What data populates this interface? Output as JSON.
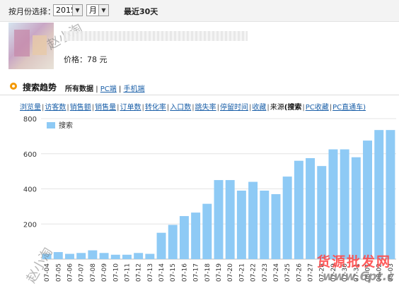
{
  "filter": {
    "label": "按月份选择：",
    "year": "2015",
    "month": "月",
    "recent": "最近30天"
  },
  "product": {
    "price_label": "价格：",
    "price_value": "78 元"
  },
  "section": {
    "title": "搜索趋势",
    "tabs": [
      "所有数据",
      "PC端",
      "手机端"
    ],
    "tab_sep": "|"
  },
  "metrics": {
    "items": [
      "浏览量",
      "访客数",
      "销售额",
      "销售量",
      "订单数",
      "转化率",
      "入口数",
      "跳失率",
      "停留时间",
      "收藏"
    ],
    "source_label": "来源",
    "source_current": "(搜索",
    "source_items": [
      "PC收藏",
      "PC直通车)"
    ],
    "sep": "|"
  },
  "watermarks": {
    "author_top": "赵小淘",
    "author_bottom": "赵小淘",
    "brand": "货源批发网",
    "url": "www.6pt.c"
  },
  "colors": {
    "bar": "#8ecaf5",
    "accent": "#f39800",
    "link": "#1a5fa8"
  },
  "chart_data": {
    "type": "bar",
    "title": "",
    "xlabel": "",
    "ylabel": "",
    "ylim": [
      0,
      800
    ],
    "yticks": [
      200,
      400,
      600,
      800
    ],
    "legend": "top-left",
    "grid": true,
    "categories": [
      "07-04",
      "07-05",
      "07-06",
      "07-07",
      "07-08",
      "07-09",
      "07-10",
      "07-11",
      "07-12",
      "07-13",
      "07-14",
      "07-15",
      "07-16",
      "07-17",
      "07-18",
      "07-19",
      "07-20",
      "07-21",
      "07-22",
      "07-23",
      "07-24",
      "07-25",
      "07-26",
      "07-27",
      "07-28",
      "07-29",
      "07-30",
      "07-31",
      "08-01",
      "08-02",
      "08-03"
    ],
    "series": [
      {
        "name": "搜索",
        "values": [
          30,
          40,
          30,
          35,
          50,
          35,
          25,
          25,
          35,
          30,
          150,
          195,
          245,
          265,
          315,
          450,
          450,
          390,
          440,
          390,
          370,
          470,
          560,
          575,
          530,
          625,
          625,
          580,
          675,
          735,
          735
        ]
      }
    ]
  }
}
